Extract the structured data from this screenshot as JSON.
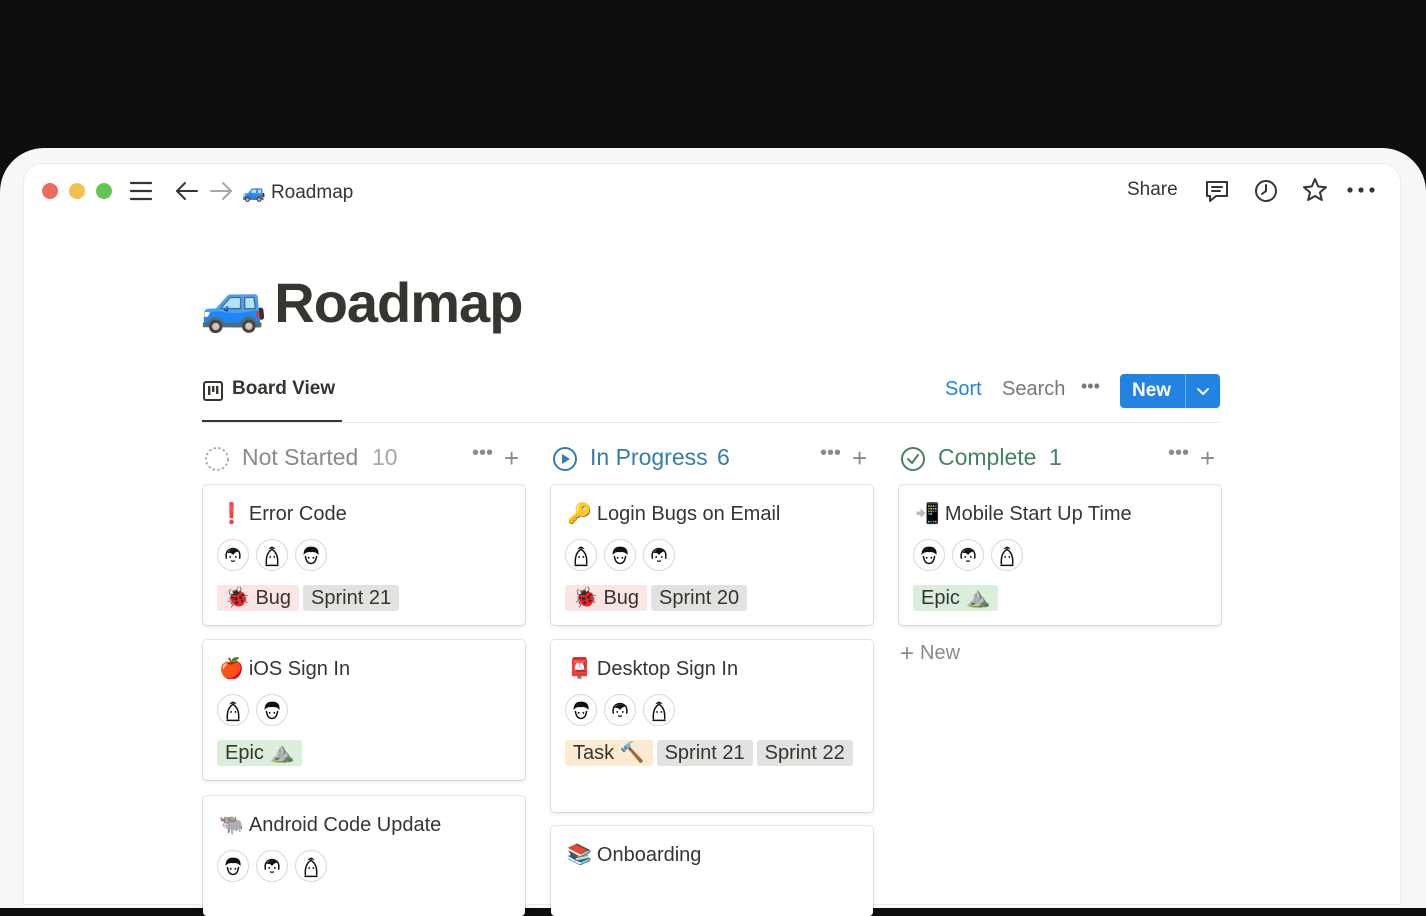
{
  "window": {
    "breadcrumb_icon": "🚙",
    "breadcrumb": "Roadmap",
    "share_label": "Share",
    "icons": [
      "sidebar-menu-icon",
      "back-arrow-icon",
      "forward-arrow-icon",
      "comment-icon",
      "clock-icon",
      "star-icon",
      "more-icon"
    ]
  },
  "page": {
    "icon": "🚙",
    "title": "Roadmap"
  },
  "view": {
    "tab_label": "Board View",
    "sort_label": "Sort",
    "search_label": "Search",
    "more_label": "•••",
    "new_label": "New"
  },
  "colors": {
    "accent": "#2383e2",
    "not_started": "#8b8a86",
    "in_progress": "#337ea9",
    "complete": "#448361"
  },
  "columns": [
    {
      "name": "Not Started",
      "count": "10",
      "cards": [
        {
          "icon": "❗",
          "title": "Error Code",
          "avatars": 3,
          "tags": [
            {
              "label": "🐞 Bug",
              "kind": "bug"
            },
            {
              "label": "Sprint 21",
              "kind": "sprint"
            }
          ]
        },
        {
          "icon": "🍎",
          "title": "iOS Sign In",
          "avatars": 2,
          "tags": [
            {
              "label": "Epic ⛰️",
              "kind": "epic"
            }
          ]
        },
        {
          "icon": "🐃",
          "title": "Android Code Update",
          "avatars": 3,
          "tags": []
        }
      ]
    },
    {
      "name": "In Progress",
      "count": "6",
      "cards": [
        {
          "icon": "🔑",
          "title": "Login Bugs on Email",
          "avatars": 3,
          "tags": [
            {
              "label": "🐞 Bug",
              "kind": "bug"
            },
            {
              "label": "Sprint 20",
              "kind": "sprint"
            }
          ]
        },
        {
          "icon": "📮",
          "title": "Desktop Sign In",
          "avatars": 3,
          "tags": [
            {
              "label": "Task 🔨",
              "kind": "task"
            },
            {
              "label": "Sprint 21",
              "kind": "sprint"
            },
            {
              "label": "Sprint 22",
              "kind": "sprint"
            }
          ]
        },
        {
          "icon": "📚",
          "title": "Onboarding",
          "avatars": 0,
          "tags": []
        }
      ]
    },
    {
      "name": "Complete",
      "count": "1",
      "cards": [
        {
          "icon": "📲",
          "title": "Mobile Start Up Time",
          "avatars": 3,
          "tags": [
            {
              "label": "Epic ⛰️",
              "kind": "epic"
            }
          ]
        }
      ],
      "add_label": "New"
    }
  ]
}
